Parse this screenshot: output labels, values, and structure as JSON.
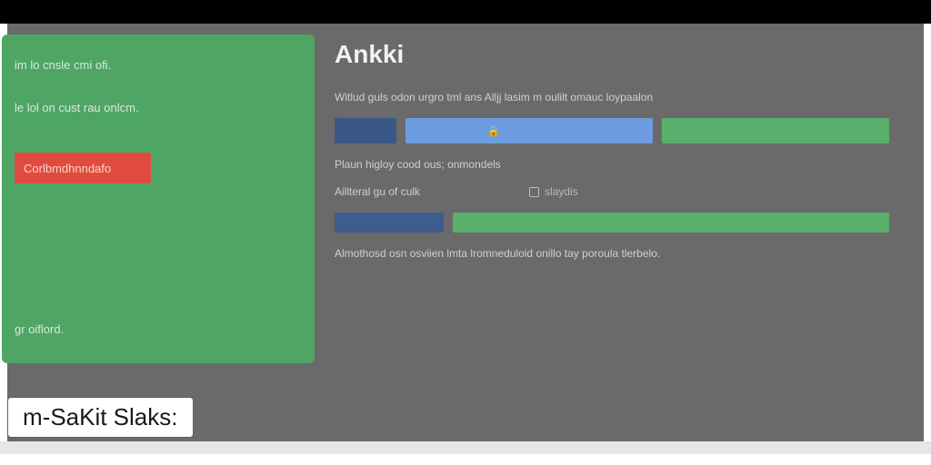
{
  "titlebar": {
    "text": ""
  },
  "green_panel": {
    "line1": "im lo cnsle cmi ofi.",
    "line2": "le lol on cust rau onlcm.",
    "button_label": "Corlbmdhnndafo",
    "line3": "gr oiflord."
  },
  "right": {
    "title": "Ankki",
    "desc1": "Witlud guls odon urgro tml ans Alljj lasim m oulilt omauc loypaalon",
    "prompt1": "Plaun higloy cood ous; onmondels",
    "field_label": "Aillteral gu of culk",
    "field_sub": "slaydis",
    "desc2": "Almothosd osn osviien lmta lromneduloid onillo tay poroula tlerbelo."
  },
  "footer_label": "m-SaKit Slaks:",
  "colors": {
    "panel_green": "#4fa564",
    "button_red": "#e14b3f",
    "bar_blue_dark": "#3a5886",
    "bar_blue_light": "#6d9de0",
    "bar_green": "#5ab06c",
    "bg_gray": "#6a6a6a"
  }
}
